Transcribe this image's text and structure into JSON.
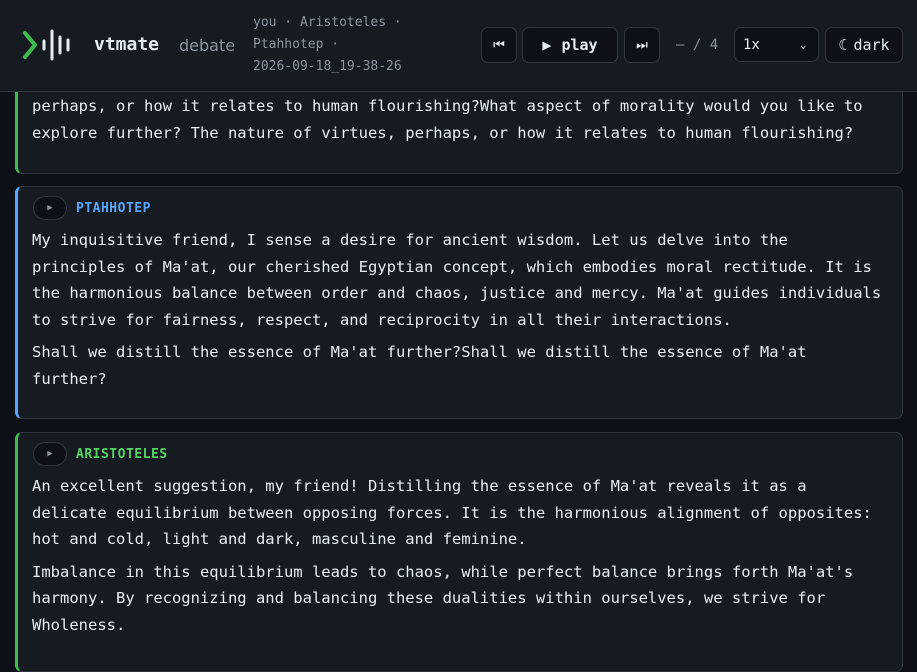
{
  "app": {
    "name": "vtmate",
    "subtitle": "debate",
    "meta_line1": "you · Aristoteles ·",
    "meta_line2": "Ptahhotep ·",
    "meta_line3": "2026-09-18_19-38-26"
  },
  "controls": {
    "prev_icon": "⏮",
    "play_icon": "▶",
    "play_label": "play",
    "next_icon": "⏭",
    "counter": "— / 4",
    "speed_value": "1x",
    "speed_options": [
      "1x"
    ],
    "theme_icon": "☾",
    "theme_label": "dark"
  },
  "colors": {
    "background": "#0d1117",
    "panel": "#161b22",
    "border": "#30363d",
    "aristoteles_accent": "#3fb950",
    "ptahhotep_accent": "#58a6ff"
  },
  "messages": [
    {
      "speaker": "",
      "paragraphs": [
        "perhaps, or how it relates to human flourishing?What aspect of morality would you like to explore further? The nature of virtues, perhaps, or how it relates to human flourishing?"
      ]
    },
    {
      "speaker": "PTAHHOTEP",
      "play_icon": "▶",
      "paragraphs": [
        "My inquisitive friend, I sense a desire for ancient wisdom. Let us delve into the principles of Ma'at, our cherished Egyptian concept, which embodies moral rectitude. It is the harmonious balance between order and chaos, justice and mercy. Ma'at guides individuals to strive for fairness, respect, and reciprocity in all their interactions.",
        "Shall we distill the essence of Ma'at further?Shall we distill the essence of Ma'at further?"
      ]
    },
    {
      "speaker": "ARISTOTELES",
      "play_icon": "▶",
      "paragraphs": [
        "An excellent suggestion, my friend! Distilling the essence of Ma'at reveals it as a delicate equilibrium between opposing forces. It is the harmonious alignment of opposites: hot and cold, light and dark, masculine and feminine.",
        "Imbalance in this equilibrium leads to chaos, while perfect balance brings forth Ma'at's harmony. By recognizing and balancing these dualities within ourselves, we strive for Wholeness."
      ]
    }
  ]
}
